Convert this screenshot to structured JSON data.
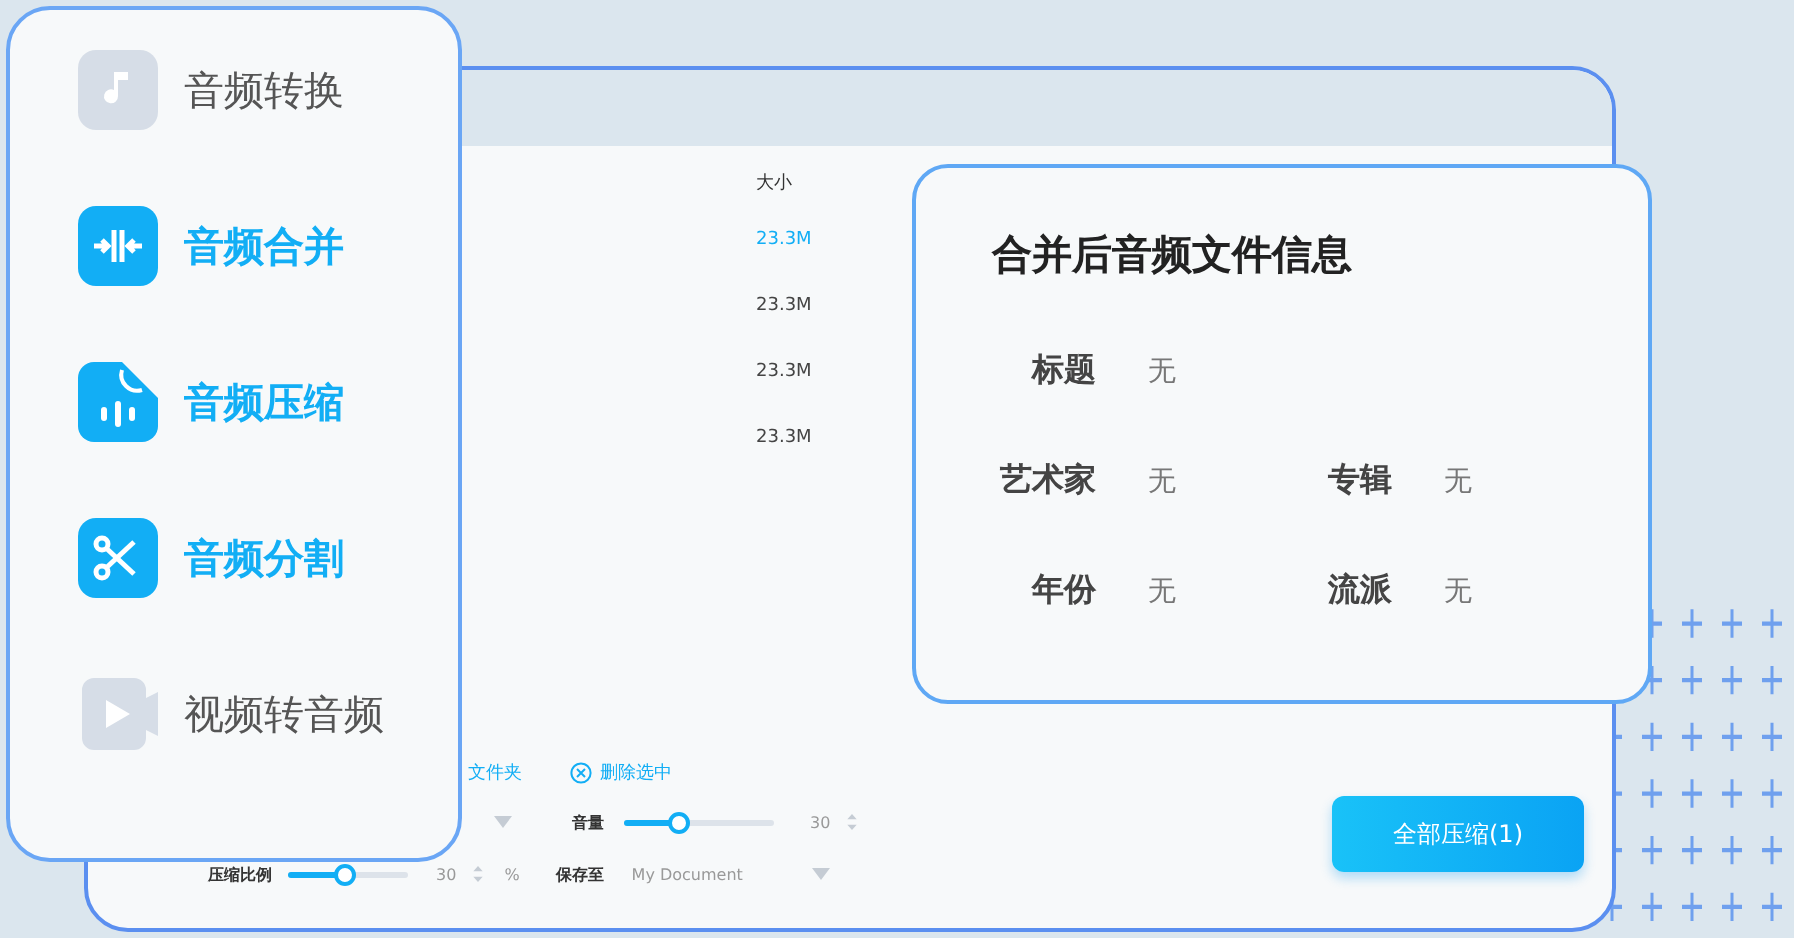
{
  "sidebar": {
    "items": [
      {
        "label": "音频转换",
        "highlighted": false
      },
      {
        "label": "音频合并",
        "highlighted": true
      },
      {
        "label": "音频压缩",
        "highlighted": true
      },
      {
        "label": "音频分割",
        "highlighted": true
      },
      {
        "label": "视频转音频",
        "highlighted": false
      }
    ]
  },
  "file_table": {
    "columns": [
      "大小"
    ],
    "rows": [
      {
        "size": "23.3M",
        "selected": true
      },
      {
        "size": "23.3M",
        "selected": false
      },
      {
        "size": "23.3M",
        "selected": false
      },
      {
        "size": "23.3M",
        "selected": false
      }
    ]
  },
  "toolbar": {
    "folder_link": "文件夹",
    "delete_button": "删除选中"
  },
  "settings": {
    "volume": {
      "label": "音量",
      "level": 0.36,
      "value": "30"
    },
    "ratio": {
      "label": "压缩比例",
      "level": 0.47,
      "value": "30",
      "unit": "%"
    },
    "save_to": {
      "label": "保存至",
      "value": "My Document"
    }
  },
  "compress_button": "全部压缩(1)",
  "info_card": {
    "title": "合并后音频文件信息",
    "fields": [
      {
        "label": "标题",
        "value": "无"
      },
      {
        "label": "艺术家",
        "value": "无"
      },
      {
        "label": "专辑",
        "value": "无"
      },
      {
        "label": "年份",
        "value": "无"
      },
      {
        "label": "流派",
        "value": "无"
      }
    ]
  }
}
